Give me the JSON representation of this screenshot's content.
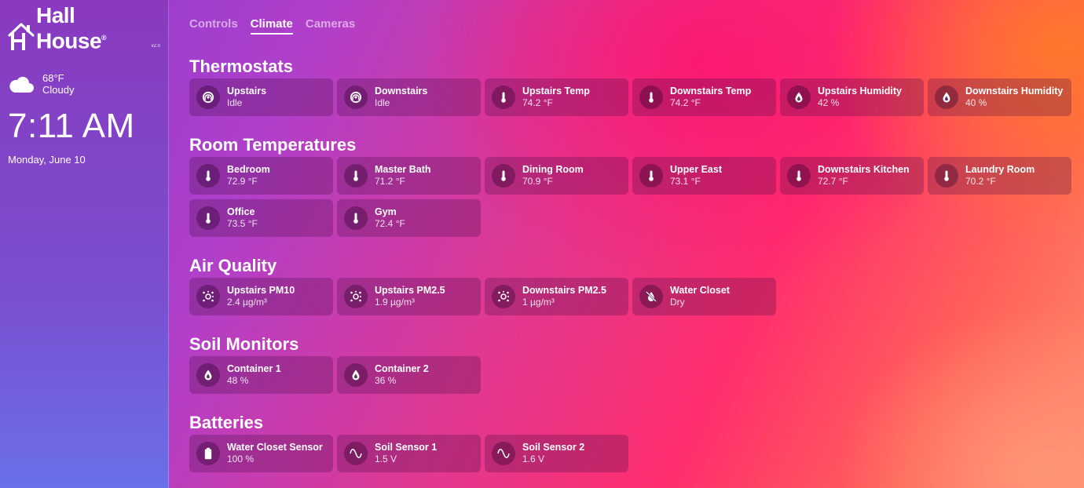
{
  "sidebar": {
    "logo_text": "Hall House",
    "logo_reg": "®",
    "logo_version": "v2.0",
    "weather": {
      "temperature": "68°F",
      "condition": "Cloudy",
      "icon": "cloud-icon"
    },
    "time": "7:11 AM",
    "date": "Monday, June 10"
  },
  "tabs": [
    {
      "label": "Controls",
      "active": false
    },
    {
      "label": "Climate",
      "active": true
    },
    {
      "label": "Cameras",
      "active": false
    }
  ],
  "sections": [
    {
      "title": "Thermostats",
      "cards": [
        {
          "name": "Upstairs",
          "value": "Idle",
          "icon": "thermostat-icon"
        },
        {
          "name": "Downstairs",
          "value": "Idle",
          "icon": "thermostat-icon"
        },
        {
          "name": "Upstairs Temp",
          "value": "74.2 °F",
          "icon": "thermometer-icon"
        },
        {
          "name": "Downstairs Temp",
          "value": "74.2 °F",
          "icon": "thermometer-icon"
        },
        {
          "name": "Upstairs Humidity",
          "value": "42 %",
          "icon": "water-drop-icon"
        },
        {
          "name": "Downstairs Humidity",
          "value": "40 %",
          "icon": "water-drop-icon"
        }
      ]
    },
    {
      "title": "Room Temperatures",
      "cards": [
        {
          "name": "Bedroom",
          "value": "72.9 °F",
          "icon": "thermometer-icon"
        },
        {
          "name": "Master Bath",
          "value": "71.2 °F",
          "icon": "thermometer-icon"
        },
        {
          "name": "Dining Room",
          "value": "70.9 °F",
          "icon": "thermometer-icon"
        },
        {
          "name": "Upper East",
          "value": "73.1 °F",
          "icon": "thermometer-icon"
        },
        {
          "name": "Downstairs Kitchen",
          "value": "72.7 °F",
          "icon": "thermometer-icon"
        },
        {
          "name": "Laundry Room",
          "value": "70.2 °F",
          "icon": "thermometer-icon"
        },
        {
          "name": "Office",
          "value": "73.5 °F",
          "icon": "thermometer-icon"
        },
        {
          "name": "Gym",
          "value": "72.4 °F",
          "icon": "thermometer-icon"
        }
      ]
    },
    {
      "title": "Air Quality",
      "cards": [
        {
          "name": "Upstairs PM10",
          "value": "2.4 µg/m³",
          "icon": "particles-icon"
        },
        {
          "name": "Upstairs PM2.5",
          "value": "1.9 µg/m³",
          "icon": "particles-icon"
        },
        {
          "name": "Downstairs PM2.5",
          "value": "1 µg/m³",
          "icon": "particles-icon"
        },
        {
          "name": "Water Closet",
          "value": "Dry",
          "icon": "water-off-icon"
        }
      ]
    },
    {
      "title": "Soil Monitors",
      "cards": [
        {
          "name": "Container 1",
          "value": "48 %",
          "icon": "water-drop-icon"
        },
        {
          "name": "Container 2",
          "value": "36 %",
          "icon": "water-drop-icon"
        }
      ]
    },
    {
      "title": "Batteries",
      "cards": [
        {
          "name": "Water Closet Sensor",
          "value": "100 %",
          "icon": "battery-icon"
        },
        {
          "name": "Soil Sensor 1",
          "value": "1.5 V",
          "icon": "sine-wave-icon"
        },
        {
          "name": "Soil Sensor 2",
          "value": "1.6 V",
          "icon": "sine-wave-icon"
        }
      ]
    }
  ]
}
